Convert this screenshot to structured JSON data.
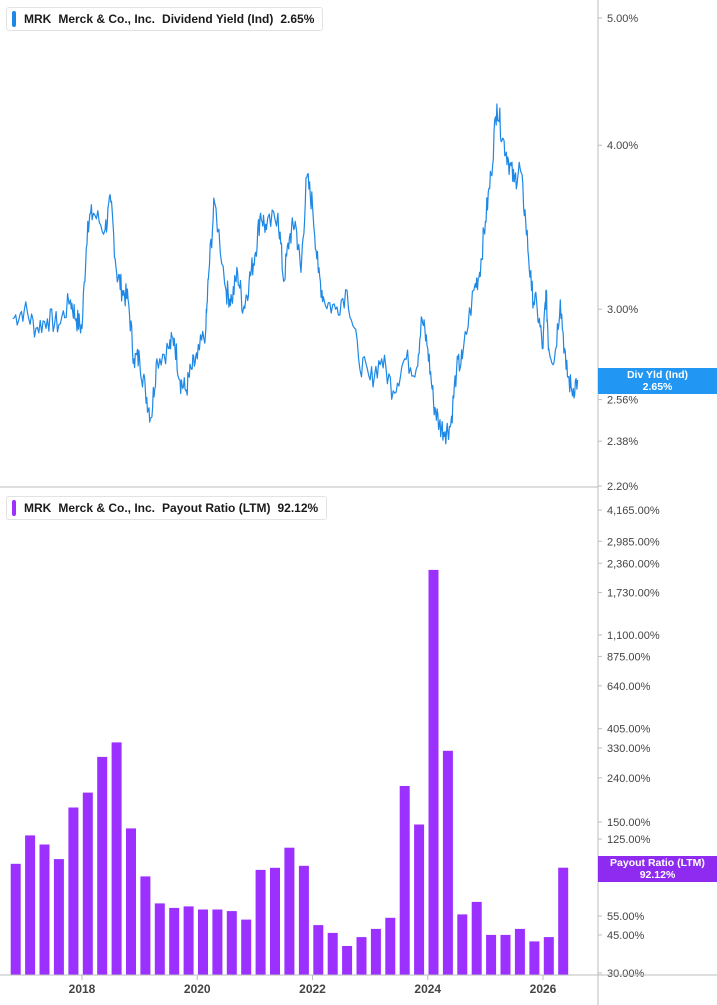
{
  "colors": {
    "yield_line": "#1e88e5",
    "yield_badge": "#2196f3",
    "payout_bar": "#9b30ff",
    "payout_badge": "#8f2bf0",
    "axis": "#bdbdbd",
    "tick_text": "#444444"
  },
  "top_legend": {
    "ticker": "MRK",
    "company": "Merck & Co., Inc.",
    "metric": "Dividend Yield (Ind)",
    "value": "2.65%"
  },
  "bottom_legend": {
    "ticker": "MRK",
    "company": "Merck & Co., Inc.",
    "metric": "Payout Ratio (LTM)",
    "value": "92.12%"
  },
  "top_badge": {
    "label": "Div Yld (Ind)",
    "value": "2.65%"
  },
  "bottom_badge": {
    "label": "Payout Ratio (LTM)",
    "value": "92.12%"
  },
  "x_axis": {
    "labels": [
      "2018",
      "2020",
      "2022",
      "2024",
      "2026"
    ]
  },
  "chart_data": [
    {
      "type": "line",
      "title": "Dividend Yield (Ind)",
      "series": [
        {
          "name": "Dividend Yield (Ind)",
          "x": [
            2016.8,
            2017.0,
            2017.2,
            2017.4,
            2017.6,
            2017.8,
            2017.9,
            2018.0,
            2018.1,
            2018.2,
            2018.4,
            2018.5,
            2018.6,
            2018.7,
            2018.8,
            2018.9,
            2019.0,
            2019.1,
            2019.2,
            2019.3,
            2019.5,
            2019.6,
            2019.7,
            2019.8,
            2019.9,
            2020.0,
            2020.15,
            2020.2,
            2020.3,
            2020.5,
            2020.6,
            2020.7,
            2020.8,
            2020.9,
            2021.0,
            2021.1,
            2021.2,
            2021.4,
            2021.5,
            2021.6,
            2021.7,
            2021.8,
            2021.9,
            2022.0,
            2022.1,
            2022.2,
            2022.4,
            2022.6,
            2022.8,
            2023.0,
            2023.2,
            2023.4,
            2023.6,
            2023.8,
            2023.9,
            2024.0,
            2024.1,
            2024.2,
            2024.3,
            2024.4,
            2024.5,
            2024.6,
            2024.8,
            2024.9,
            2025.0,
            2025.1,
            2025.2,
            2025.3,
            2025.4,
            2025.5,
            2025.6,
            2025.7,
            2025.8,
            2025.9,
            2026.0,
            2026.05,
            2026.1,
            2026.2,
            2026.3,
            2026.4,
            2026.5,
            2026.6
          ],
          "values": [
            2.95,
            3.0,
            2.9,
            2.95,
            2.92,
            3.05,
            2.95,
            2.9,
            3.5,
            3.55,
            3.45,
            3.62,
            3.2,
            3.1,
            3.05,
            2.75,
            2.75,
            2.6,
            2.48,
            2.75,
            2.8,
            2.85,
            2.65,
            2.6,
            2.7,
            2.75,
            2.9,
            3.2,
            3.62,
            3.1,
            3.05,
            3.2,
            3.0,
            3.15,
            3.3,
            3.55,
            3.45,
            3.55,
            3.15,
            3.4,
            3.5,
            3.2,
            3.78,
            3.6,
            3.2,
            3.05,
            3.0,
            3.1,
            2.75,
            2.65,
            2.75,
            2.6,
            2.75,
            2.7,
            2.95,
            2.8,
            2.55,
            2.45,
            2.42,
            2.45,
            2.7,
            2.75,
            3.1,
            3.2,
            3.5,
            3.8,
            4.3,
            4.05,
            3.9,
            3.75,
            3.85,
            3.5,
            3.1,
            3.0,
            2.8,
            3.1,
            2.8,
            2.75,
            3.05,
            2.7,
            2.6,
            2.65
          ],
          "ylim": [
            2.2,
            5.0
          ],
          "y_tick_labels": [
            "5.00%",
            "4.00%",
            "3.00%",
            "2.56%",
            "2.38%",
            "2.20%"
          ],
          "scale": "log"
        }
      ]
    },
    {
      "type": "bar",
      "title": "Payout Ratio (LTM)",
      "series": [
        {
          "name": "Payout Ratio (LTM)",
          "x": [
            2016.85,
            2017.1,
            2017.35,
            2017.6,
            2017.85,
            2018.1,
            2018.35,
            2018.6,
            2018.85,
            2019.1,
            2019.35,
            2019.6,
            2019.85,
            2020.1,
            2020.35,
            2020.6,
            2020.85,
            2021.1,
            2021.35,
            2021.6,
            2021.85,
            2022.1,
            2022.35,
            2022.6,
            2022.85,
            2023.1,
            2023.35,
            2023.6,
            2023.85,
            2024.1,
            2024.35,
            2024.6,
            2024.85,
            2025.1,
            2025.35,
            2025.6,
            2025.85,
            2026.1,
            2026.35
          ],
          "values": [
            96,
            130,
            118,
            101,
            175,
            205,
            300,
            350,
            140,
            84,
            63,
            60,
            61,
            59,
            59,
            58,
            53,
            90,
            92,
            114,
            94,
            50,
            46,
            40,
            44,
            48,
            54,
            220,
            146,
            2200,
            320,
            56,
            64,
            45,
            45,
            48,
            42,
            44,
            92.12
          ],
          "y_tick_labels": [
            "4,165.00%",
            "2,985.00%",
            "2,360.00%",
            "1,730.00%",
            "1,100.00%",
            "875.00%",
            "640.00%",
            "405.00%",
            "330.00%",
            "240.00%",
            "150.00%",
            "125.00%",
            "55.00%",
            "45.00%",
            "30.00%"
          ],
          "scale": "log"
        }
      ]
    }
  ]
}
